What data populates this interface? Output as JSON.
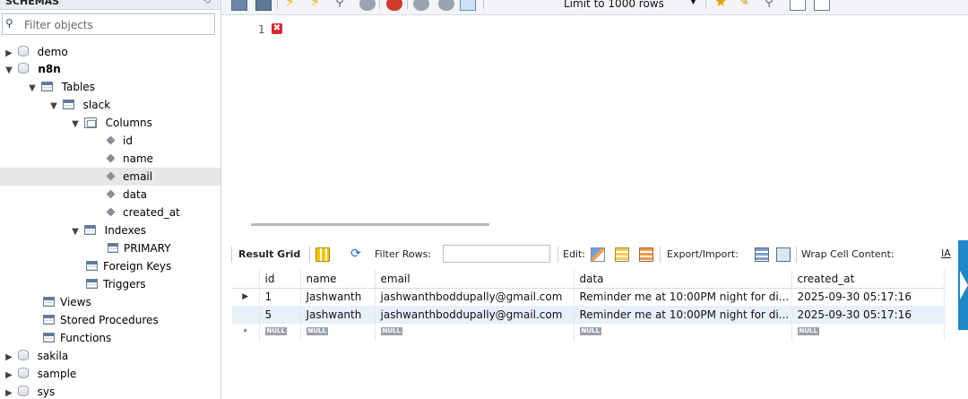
{
  "sidebar": {
    "header_title": "SCHEMAS",
    "filter_placeholder": "Filter objects",
    "schemas": [
      {
        "name": "demo",
        "expanded": false
      },
      {
        "name": "n8n",
        "expanded": true
      },
      {
        "name": "sakila",
        "expanded": false
      },
      {
        "name": "sample",
        "expanded": false
      },
      {
        "name": "sys",
        "expanded": false
      }
    ],
    "tree": {
      "tables_label": "Tables",
      "table_name": "slack",
      "columns_label": "Columns",
      "columns": [
        "id",
        "name",
        "email",
        "data",
        "created_at"
      ],
      "selected_column": "email",
      "indexes_label": "Indexes",
      "index_primary": "PRIMARY",
      "foreign_keys_label": "Foreign Keys",
      "triggers_label": "Triggers",
      "views_label": "Views",
      "stored_procedures_label": "Stored Procedures",
      "functions_label": "Functions"
    }
  },
  "toolbar": {
    "limit_label": "Limit to 1000 rows"
  },
  "editor": {
    "line_number": "1",
    "error_mark": "✖"
  },
  "result": {
    "toolbar": {
      "result_grid_label": "Result Grid",
      "filter_rows_label": "Filter Rows:",
      "edit_label": "Edit:",
      "export_import_label": "Export/Import:",
      "wrap_label": "Wrap Cell Content:",
      "wrap_glyph": "IA"
    },
    "columns": [
      "id",
      "name",
      "email",
      "data",
      "created_at"
    ],
    "rows": [
      {
        "marker": "▶",
        "id": "1",
        "name": "Jashwanth",
        "email": "jashwanthboddupally@gmail.com",
        "data": "Reminder me at 10:00PM night for di...",
        "created_at": "2025-09-30 05:17:16"
      },
      {
        "marker": "",
        "id": "5",
        "name": "Jashwanth",
        "email": "jashwanthboddupally@gmail.com",
        "data": "Reminder me at 10:00PM night for di...",
        "created_at": "2025-09-30 05:17:16"
      }
    ],
    "new_row": {
      "marker": "*",
      "null_label": "NULL"
    }
  }
}
